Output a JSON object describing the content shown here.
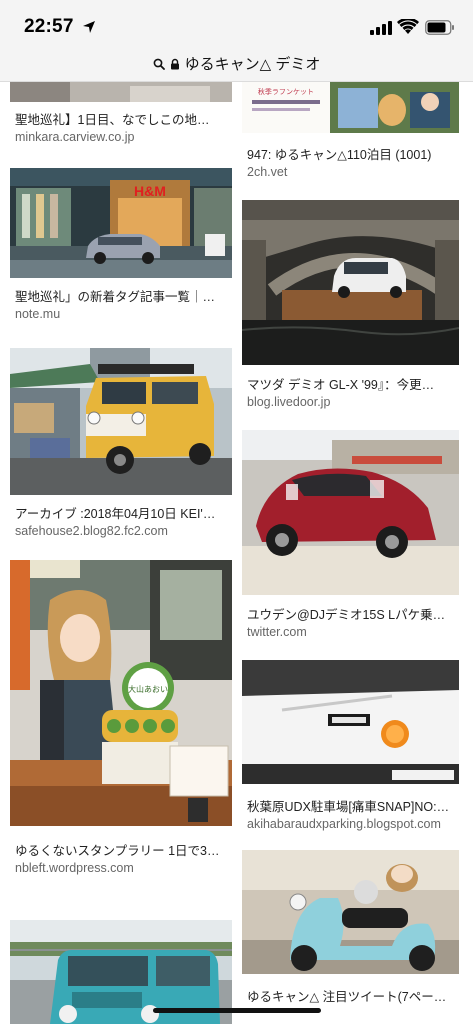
{
  "status_bar": {
    "time": "22:57"
  },
  "address_bar": {
    "query": "ゆるキャン△ デミオ"
  },
  "results": {
    "left": [
      {
        "title": "聖地巡礼】1日目、なでしこの地…",
        "domain": "minkara.carview.co.jp"
      },
      {
        "title": "聖地巡礼」の新着タグ記事一覧｜…",
        "domain": "note.mu",
        "sign": "H&M"
      },
      {
        "title": "アーカイブ :2018年04月10日 KEI'…",
        "domain": "safehouse2.blog82.fc2.com"
      },
      {
        "title": "ゆるくないスタンプラリー 1日で3…",
        "domain": "nbleft.wordpress.com",
        "badge": "大山あおい"
      },
      {
        "title": "",
        "domain": ""
      }
    ],
    "right": [
      {
        "title": "947: ゆるキャン△110泊目 (1001)",
        "domain": "2ch.vet",
        "banner": "秋季ラフンケット"
      },
      {
        "title": "マツダ デミオ GL-X '99』：今更…",
        "domain": "blog.livedoor.jp"
      },
      {
        "title": "ユウデン@DJデミオ15S Lパケ乗…",
        "domain": "twitter.com"
      },
      {
        "title": "秋葉原UDX駐車場[痛車SNAP]NO:…",
        "domain": "akihabaraudxparking.blogspot.com"
      },
      {
        "title": "ゆるキャン△ 注目ツイート(7ペー…",
        "domain": ""
      }
    ]
  }
}
